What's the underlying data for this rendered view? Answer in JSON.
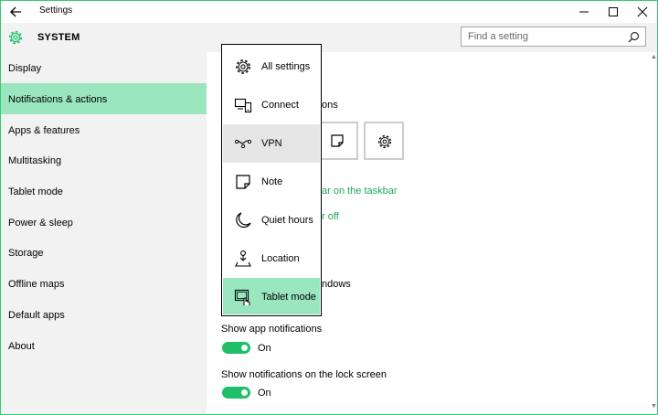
{
  "window": {
    "title": "Settings"
  },
  "header": {
    "section": "SYSTEM"
  },
  "search": {
    "placeholder": "Find a setting"
  },
  "sidebar": {
    "items": [
      {
        "label": "Display"
      },
      {
        "label": "Notifications & actions"
      },
      {
        "label": "Apps & features"
      },
      {
        "label": "Multitasking"
      },
      {
        "label": "Tablet mode"
      },
      {
        "label": "Power & sleep"
      },
      {
        "label": "Storage"
      },
      {
        "label": "Offline maps"
      },
      {
        "label": "Default apps"
      },
      {
        "label": "About"
      }
    ]
  },
  "content": {
    "partial_texts": {
      "actions_tail": "ons",
      "taskbar_link_tail": "ar on the taskbar",
      "off_link_tail": "r off",
      "windows_tail": "ndows"
    },
    "show_app_notifications": {
      "label": "Show app notifications",
      "state": "On"
    },
    "show_lock_screen": {
      "label": "Show notifications on the lock screen",
      "state": "On"
    }
  },
  "flyout": {
    "items": [
      {
        "label": "All settings",
        "icon": "gear-icon"
      },
      {
        "label": "Connect",
        "icon": "connect-icon"
      },
      {
        "label": "VPN",
        "icon": "vpn-icon"
      },
      {
        "label": "Note",
        "icon": "note-icon"
      },
      {
        "label": "Quiet hours",
        "icon": "moon-icon"
      },
      {
        "label": "Location",
        "icon": "location-icon"
      },
      {
        "label": "Tablet mode",
        "icon": "tablet-mode-icon"
      }
    ]
  },
  "colors": {
    "accent": "#1fbf6a",
    "selection": "#99e6bf",
    "hover": "#e6e6e6",
    "link": "#1faa59"
  }
}
